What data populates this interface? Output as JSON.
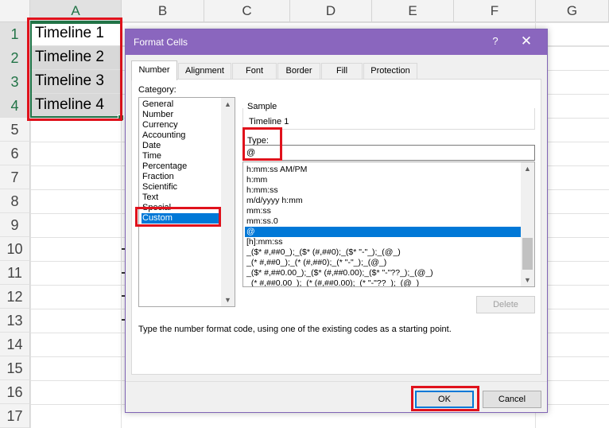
{
  "sheet": {
    "columns": [
      "A",
      "B",
      "C",
      "D",
      "E",
      "F",
      "G"
    ],
    "rows": [
      "1",
      "2",
      "3",
      "4",
      "5",
      "6",
      "7",
      "8",
      "9",
      "10",
      "11",
      "12",
      "13",
      "14",
      "15",
      "16",
      "17"
    ],
    "cells": [
      "Timeline 1",
      "Timeline 2",
      "Timeline 3",
      "Timeline 4"
    ]
  },
  "dialog": {
    "title": "Format Cells",
    "help": "?",
    "close": "✕",
    "tabs": [
      "Number",
      "Alignment",
      "Font",
      "Border",
      "Fill",
      "Protection"
    ],
    "category_label": "Category:",
    "categories": [
      "General",
      "Number",
      "Currency",
      "Accounting",
      "Date",
      "Time",
      "Percentage",
      "Fraction",
      "Scientific",
      "Text",
      "Special",
      "Custom"
    ],
    "selected_category": "Custom",
    "sample_label": "Sample",
    "sample_value": "Timeline 1",
    "type_label": "Type:",
    "type_value": "@",
    "formats": [
      "h:mm:ss AM/PM",
      "h:mm",
      "h:mm:ss",
      "m/d/yyyy h:mm",
      "mm:ss",
      "mm:ss.0",
      "@",
      "[h]:mm:ss",
      "_($* #,##0_);_($* (#,##0);_($* \"-\"_);_(@_)",
      "_(* #,##0_);_(* (#,##0);_(* \"-\"_);_(@_)",
      "_($* #,##0.00_);_($* (#,##0.00);_($* \"-\"??_);_(@_)",
      "_(* #,##0.00_);_(* (#,##0.00);_(* \"-\"??_);_(@_)"
    ],
    "selected_format": "@",
    "delete_label": "Delete",
    "hint": "Type the number format code, using one of the existing codes as a starting point.",
    "ok_label": "OK",
    "cancel_label": "Cancel"
  },
  "colors": {
    "titlebar": "#8a66be",
    "highlight_box": "#e0121c",
    "selection": "#0078d7",
    "excel_green": "#217346"
  }
}
